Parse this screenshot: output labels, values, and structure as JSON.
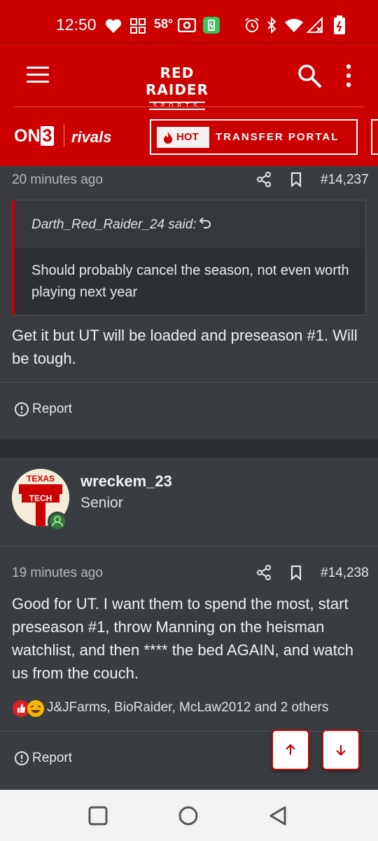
{
  "status_bar": {
    "time": "12:50",
    "temperature": "58°"
  },
  "header": {
    "logo_line1": "RED RAIDER",
    "logo_line2": "SPORTS",
    "on3_prefix": "ON",
    "on3_digit": "3",
    "rivals": "rivals",
    "hot_badge": "HOT",
    "transfer_portal": "TRANSFER PORTAL"
  },
  "posts": [
    {
      "time": "20 minutes ago",
      "number": "#14,237",
      "quote": {
        "author": "Darth_Red_Raider_24 said:",
        "text": "Should probably cancel the season, not even worth playing next year"
      },
      "body": "Get it but UT will be loaded and preseason #1. Will be tough.",
      "report_label": "Report"
    },
    {
      "avatar_line1": "TEXAS",
      "avatar_line2": "TECH",
      "username": "wreckem_23",
      "user_title": "Senior",
      "time": "19 minutes ago",
      "number": "#14,238",
      "body": "Good for UT. I want them to spend the most, start preseason #1, throw Manning on the heisman watchlist, and then **** the bed AGAIN, and watch us from the couch.",
      "reactions": "J&JFarms, BioRaider, McLaw2012 and 2 others",
      "report_label": "Report"
    }
  ],
  "colors": {
    "brand_red": "#cc0000",
    "background": "#2e3338",
    "card": "#393d42",
    "online": "#2e7d32"
  },
  "icons": [
    "heart-icon",
    "grid-icon",
    "battery-icon",
    "alarm-icon",
    "bluetooth-icon",
    "wifi-icon",
    "signal-icon",
    "menu-icon",
    "search-icon",
    "kebab-icon",
    "flame-icon",
    "share-icon",
    "bookmark-icon",
    "return-icon",
    "report-icon",
    "like-icon",
    "laugh-icon",
    "arrow-up-icon",
    "arrow-down-icon",
    "square-nav-icon",
    "circle-nav-icon",
    "back-nav-icon"
  ]
}
